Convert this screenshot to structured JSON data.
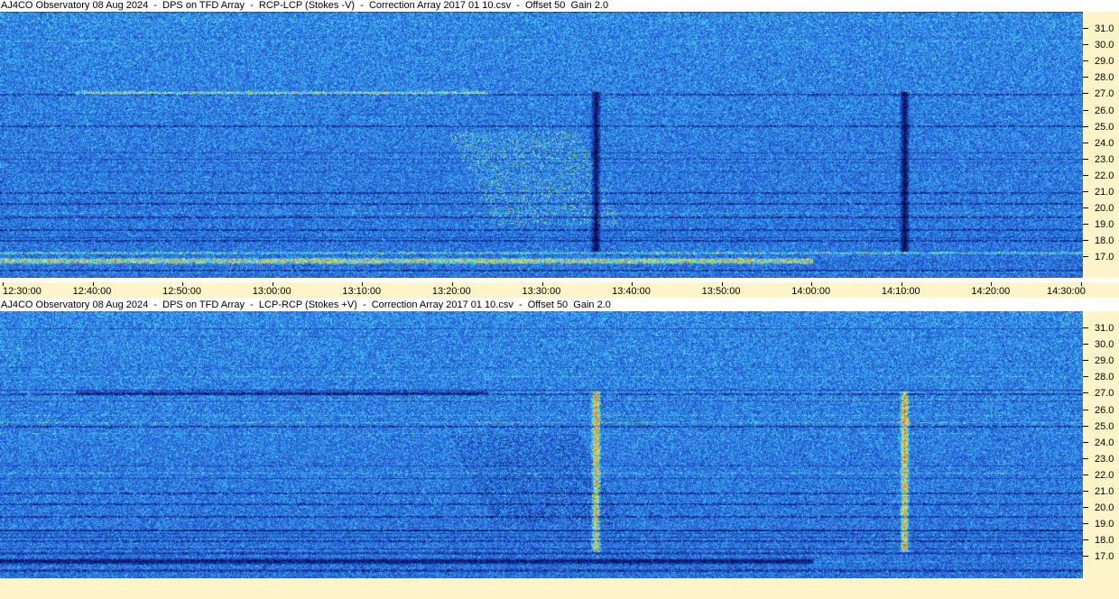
{
  "panels": [
    {
      "title": "AJ4CO Observatory 08 Aug 2024  -  DPS on TFD Array  -  RCP-LCP (Stokes -V)  -  Correction Array 2017 01 10.csv  -  Offset 50  Gain 2.0",
      "mode": "rcp-lcp"
    },
    {
      "title": "AJ4CO Observatory 08 Aug 2024  -  DPS on TFD Array  -  LCP-RCP (Stokes +V)  -  Correction Array 2017 01 10.csv  -  Offset 50  Gain 2.0",
      "mode": "lcp-rcp"
    }
  ],
  "y_ticks": [
    "31.0",
    "30.0",
    "29.0",
    "28.0",
    "27.0",
    "26.0",
    "25.0",
    "24.0",
    "23.0",
    "22.0",
    "21.0",
    "20.0",
    "19.0",
    "18.0",
    "17.0"
  ],
  "x_ticks": [
    "12:30:00",
    "12:40:00",
    "12:50:00",
    "13:00:00",
    "13:10:00",
    "13:20:00",
    "13:30:00",
    "13:40:00",
    "13:50:00",
    "14:00:00",
    "14:10:00",
    "14:20:00",
    "14:30:00"
  ],
  "colors": {
    "axis_background": "#fdf5c9",
    "spectrogram_base": "#2a6fd6"
  }
}
